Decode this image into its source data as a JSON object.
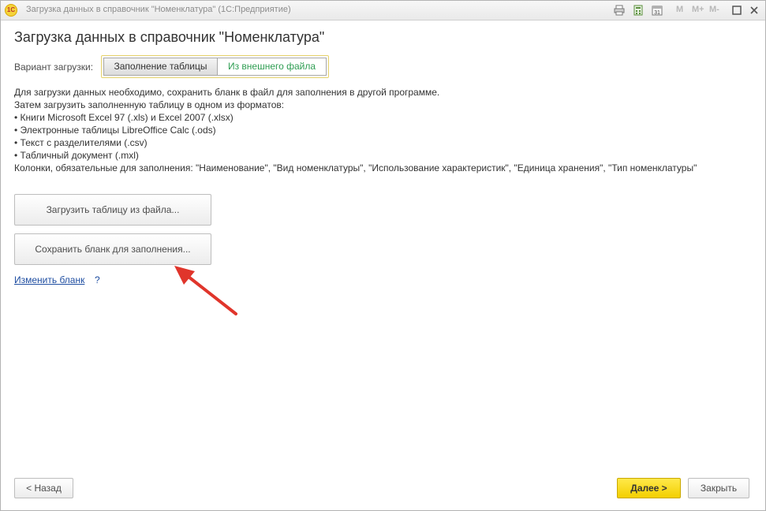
{
  "window": {
    "logo_text": "1С",
    "title": "Загрузка данных в справочник \"Номенклатура\"  (1С:Предприятие)",
    "toolbar_icons": [
      "print-icon",
      "calculator-icon",
      "calendar-icon"
    ],
    "calendar_day": "31",
    "memory_labels": [
      "M",
      "M+",
      "M-"
    ],
    "controls": [
      "restore-icon",
      "close-icon"
    ]
  },
  "page": {
    "title": "Загрузка данных в справочник \"Номенклатура\""
  },
  "variant": {
    "label": "Вариант загрузки:",
    "options": [
      "Заполнение таблицы",
      "Из внешнего файла"
    ],
    "selected": "Из внешнего файла"
  },
  "description": {
    "lines": [
      "Для загрузки данных необходимо, сохранить бланк в файл для заполнения в другой программе.",
      "Затем загрузить заполненную таблицу в одном из форматов:",
      "• Книги Microsoft Excel 97 (.xls) и Excel 2007 (.xlsx)",
      "• Электронные таблицы LibreOffice Calc (.ods)",
      "• Текст с разделителями (.csv)",
      "• Табличный документ (.mxl)",
      "Колонки, обязательные для заполнения: \"Наименование\", \"Вид номенклатуры\", \"Использование характеристик\", \"Единица хранения\", \"Тип номенклатуры\""
    ]
  },
  "actions": {
    "load_label": "Загрузить таблицу из файла...",
    "save_label": "Сохранить бланк для заполнения...",
    "change_link": "Изменить бланк",
    "help": "?"
  },
  "footer": {
    "back_label": "< Назад",
    "next_label": "Далее >",
    "close_label": "Закрыть"
  },
  "colors": {
    "accent_yellow": "#f3cf00",
    "selected_green": "#2e9d52",
    "link_blue": "#1f4ea1",
    "annotation_red": "#e0352b"
  }
}
